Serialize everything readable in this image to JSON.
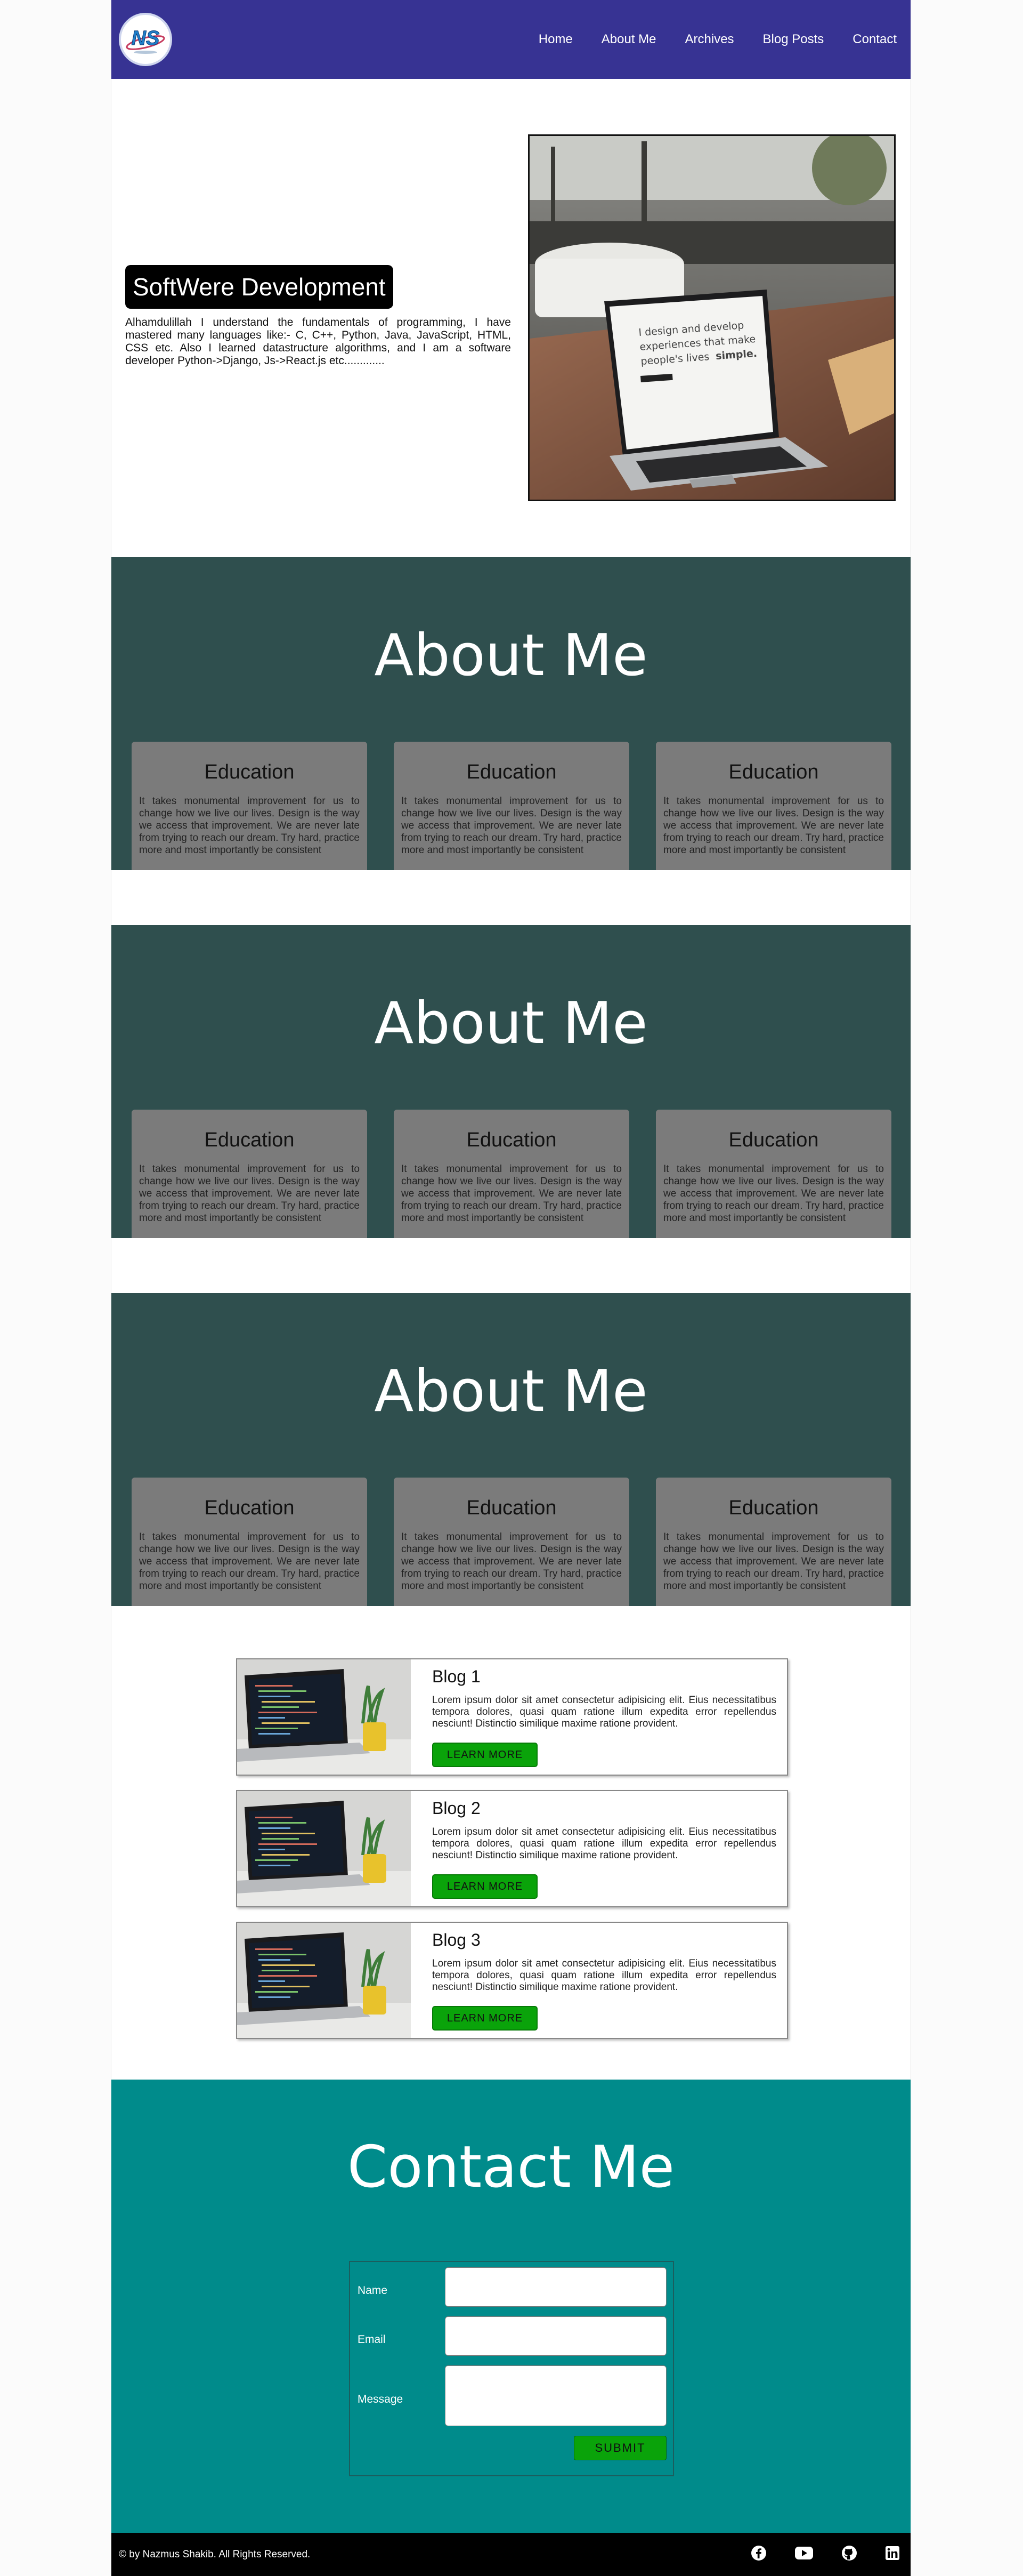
{
  "nav": {
    "logo_text": "NS",
    "links": [
      "Home",
      "About Me",
      "Archives",
      "Blog Posts",
      "Contact"
    ]
  },
  "hero": {
    "title": "SoftWere Development",
    "text": "Alhamdulillah I understand the fundamentals of programming, I have mastered many languages like:- C, C++, Python, Java, JavaScript, HTML, CSS etc. Also I learned datastructure algorithms, and I am a software developer Python->Django, Js->React.js etc.............",
    "image": {
      "screen_line1": "I design and develop",
      "screen_line2": "experiences that make",
      "screen_line3": "people's lives",
      "screen_emph": "simple."
    }
  },
  "about_sections": [
    {
      "heading": "About Me",
      "cards": [
        {
          "title": "Education",
          "text": "It takes monumental improvement for us to change how we live our lives. Design is the way we access that improvement. We are never late from trying to reach our dream. Try hard, practice more and most importantly be consistent"
        },
        {
          "title": "Education",
          "text": "It takes monumental improvement for us to change how we live our lives. Design is the way we access that improvement. We are never late from trying to reach our dream. Try hard, practice more and most importantly be consistent"
        },
        {
          "title": "Education",
          "text": "It takes monumental improvement for us to change how we live our lives. Design is the way we access that improvement. We are never late from trying to reach our dream. Try hard, practice more and most importantly be consistent"
        }
      ]
    },
    {
      "heading": "About Me",
      "cards": [
        {
          "title": "Education",
          "text": "It takes monumental improvement for us to change how we live our lives. Design is the way we access that improvement. We are never late from trying to reach our dream. Try hard, practice more and most importantly be consistent"
        },
        {
          "title": "Education",
          "text": "It takes monumental improvement for us to change how we live our lives. Design is the way we access that improvement. We are never late from trying to reach our dream. Try hard, practice more and most importantly be consistent"
        },
        {
          "title": "Education",
          "text": "It takes monumental improvement for us to change how we live our lives. Design is the way we access that improvement. We are never late from trying to reach our dream. Try hard, practice more and most importantly be consistent"
        }
      ]
    },
    {
      "heading": "About Me",
      "cards": [
        {
          "title": "Education",
          "text": "It takes monumental improvement for us to change how we live our lives. Design is the way we access that improvement. We are never late from trying to reach our dream. Try hard, practice more and most importantly be consistent"
        },
        {
          "title": "Education",
          "text": "It takes monumental improvement for us to change how we live our lives. Design is the way we access that improvement. We are never late from trying to reach our dream. Try hard, practice more and most importantly be consistent"
        },
        {
          "title": "Education",
          "text": "It takes monumental improvement for us to change how we live our lives. Design is the way we access that improvement. We are never late from trying to reach our dream. Try hard, practice more and most importantly be consistent"
        }
      ]
    }
  ],
  "blogs": [
    {
      "title": "Blog 1",
      "text": "Lorem ipsum dolor sit amet consectetur adipisicing elit. Eius necessitatibus tempora dolores, quasi quam ratione illum expedita error repellendus nesciunt! Distinctio similique maxime ratione provident.",
      "button": "LEARN MORE"
    },
    {
      "title": "Blog 2",
      "text": "Lorem ipsum dolor sit amet consectetur adipisicing elit. Eius necessitatibus tempora dolores, quasi quam ratione illum expedita error repellendus nesciunt! Distinctio similique maxime ratione provident.",
      "button": "LEARN MORE"
    },
    {
      "title": "Blog 3",
      "text": "Lorem ipsum dolor sit amet consectetur adipisicing elit. Eius necessitatibus tempora dolores, quasi quam ratione illum expedita error repellendus nesciunt! Distinctio similique maxime ratione provident.",
      "button": "LEARN MORE"
    }
  ],
  "contact": {
    "heading": "Contact Me",
    "name_label": "Name",
    "email_label": "Email",
    "message_label": "Message",
    "name_value": "",
    "email_value": "",
    "message_value": "",
    "submit_label": "SUBMIT"
  },
  "footer": {
    "copyright": "© by Nazmus Shakib. All Rights Reserved.",
    "icons": [
      "facebook-icon",
      "youtube-icon",
      "github-icon",
      "linkedin-icon"
    ]
  },
  "colors": {
    "nav_bg": "#373393",
    "about_bg": "#2f4f4e",
    "card_bg": "#7b7b7b",
    "contact_bg": "#008b8b",
    "button_green": "#0aa30a",
    "footer_bg": "#000000"
  }
}
